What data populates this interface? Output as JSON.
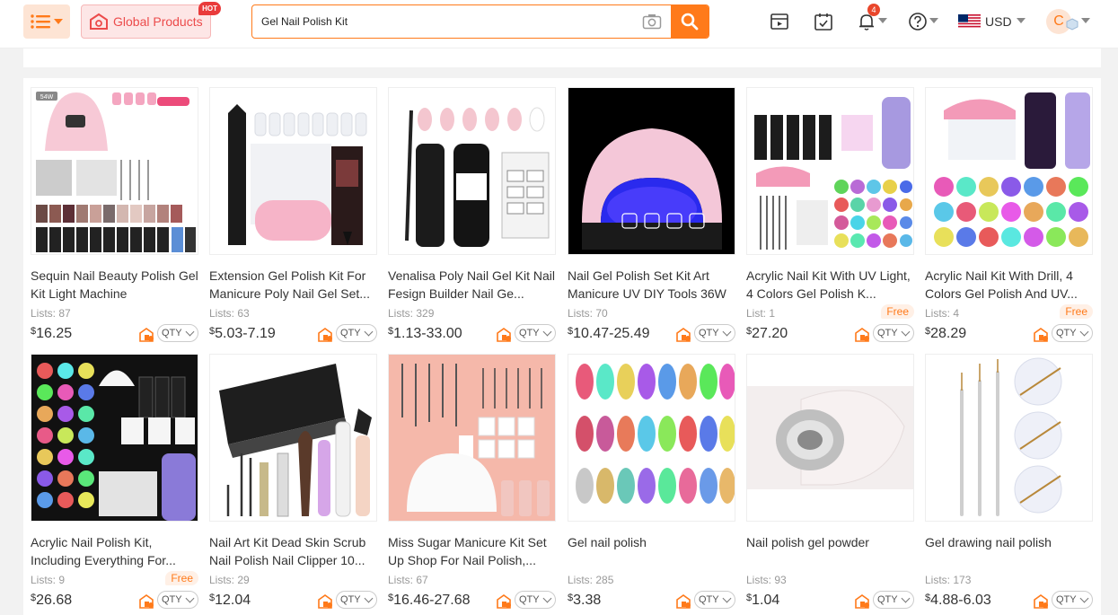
{
  "header": {
    "global_products_label": "Global Products",
    "hot_badge": "HOT",
    "search": {
      "value": "Gel Nail Polish Kit",
      "placeholder": ""
    },
    "notification_count": "4",
    "currency": "USD",
    "avatar_initial": "C",
    "icons": [
      "menu-icon",
      "store-icon",
      "camera-icon",
      "search-icon",
      "video-icon",
      "checklist-icon",
      "bell-icon",
      "help-icon",
      "us-flag-icon"
    ],
    "accent_color": "#ff7a1a"
  },
  "products": [
    {
      "title": "Sequin Nail Beauty Polish Gel Kit Light Machine",
      "lists_label": "Lists:",
      "lists": "87",
      "free": "",
      "currency_symbol": "$",
      "price": "16.25",
      "qty_label": "QTY"
    },
    {
      "title": "Extension Gel Polish Kit For Manicure Poly Nail Gel Set...",
      "lists_label": "Lists:",
      "lists": "63",
      "free": "",
      "currency_symbol": "$",
      "price": "5.03-7.19",
      "qty_label": "QTY"
    },
    {
      "title": "Venalisa Poly Nail Gel Kit Nail Fesign Builder Nail Ge...",
      "lists_label": "Lists:",
      "lists": "329",
      "free": "",
      "currency_symbol": "$",
      "price": "1.13-33.00",
      "qty_label": "QTY"
    },
    {
      "title": "Nail Gel Polish Set Kit Art Manicure UV DIY Tools 36W",
      "lists_label": "Lists:",
      "lists": "70",
      "free": "",
      "currency_symbol": "$",
      "price": "10.47-25.49",
      "qty_label": "QTY"
    },
    {
      "title": "Acrylic Nail Kit With UV Light, 4 Colors Gel Polish K...",
      "lists_label": "List:",
      "lists": "1",
      "free": "Free",
      "currency_symbol": "$",
      "price": "27.20",
      "qty_label": "QTY"
    },
    {
      "title": "Acrylic Nail Kit With Drill, 4 Colors Gel Polish And UV...",
      "lists_label": "Lists:",
      "lists": "4",
      "free": "Free",
      "currency_symbol": "$",
      "price": "28.29",
      "qty_label": "QTY"
    },
    {
      "title": "Acrylic Nail Polish Kit, Including Everything For...",
      "lists_label": "Lists:",
      "lists": "9",
      "free": "Free",
      "currency_symbol": "$",
      "price": "26.68",
      "qty_label": "QTY"
    },
    {
      "title": "Nail Art Kit Dead Skin Scrub Nail Polish Nail Clipper 10...",
      "lists_label": "Lists:",
      "lists": "29",
      "free": "",
      "currency_symbol": "$",
      "price": "12.04",
      "qty_label": "QTY"
    },
    {
      "title": "Miss Sugar Manicure Kit Set Up Shop For Nail Polish,...",
      "lists_label": "Lists:",
      "lists": "67",
      "free": "",
      "currency_symbol": "$",
      "price": "16.46-27.68",
      "qty_label": "QTY"
    },
    {
      "title": "Gel nail polish",
      "lists_label": "Lists:",
      "lists": "285",
      "free": "",
      "currency_symbol": "$",
      "price": "3.38",
      "qty_label": "QTY"
    },
    {
      "title": "Nail polish gel powder",
      "lists_label": "Lists:",
      "lists": "93",
      "free": "",
      "currency_symbol": "$",
      "price": "1.04",
      "qty_label": "QTY"
    },
    {
      "title": "Gel drawing nail polish",
      "lists_label": "Lists:",
      "lists": "173",
      "free": "",
      "currency_symbol": "$",
      "price": "4.88-6.03",
      "qty_label": "QTY"
    }
  ],
  "thumb_labels": {
    "lamp_watt": "54W"
  }
}
